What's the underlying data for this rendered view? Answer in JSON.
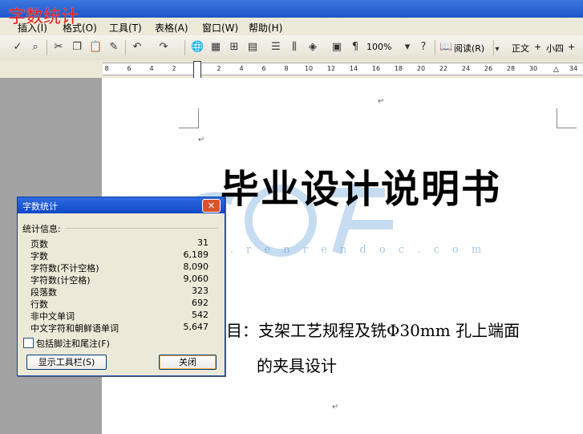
{
  "banner": "字数统计",
  "menu": [
    "插入(I)",
    "格式(O)",
    "工具(T)",
    "表格(A)",
    "窗口(W)",
    "帮助(H)"
  ],
  "toolbar": {
    "zoom": "100%",
    "read_label": "阅读(R)",
    "style_value": "正文",
    "font_size": "小四"
  },
  "ruler": [
    "8",
    "6",
    "4",
    "2",
    "2",
    "4",
    "6",
    "8",
    "10",
    "12",
    "14",
    "16",
    "18",
    "20",
    "22",
    "24",
    "26",
    "28",
    "30",
    "34"
  ],
  "document": {
    "title": "毕业设计说明书",
    "line1": "目：支架工艺规程及铣Φ30mm 孔上端面",
    "line2": "的夹具设计",
    "para_mark": "↵"
  },
  "watermark": {
    "url": "w w w . r e n r e n d o c . c o m"
  },
  "dialog": {
    "title": "字数统计",
    "close_glyph": "✕",
    "section": "统计信息:",
    "stats": [
      {
        "label": "页数",
        "value": "31"
      },
      {
        "label": "字数",
        "value": "6,189"
      },
      {
        "label": "字符数(不计空格)",
        "value": "8,090"
      },
      {
        "label": "字符数(计空格)",
        "value": "9,060"
      },
      {
        "label": "段落数",
        "value": "323"
      },
      {
        "label": "行数",
        "value": "692"
      },
      {
        "label": "非中文单词",
        "value": "542"
      },
      {
        "label": "中文字符和朝鲜语单词",
        "value": "5,647"
      }
    ],
    "include_footnotes": "包括脚注和尾注(F)",
    "show_toolbar": "显示工具栏(S)",
    "close": "关闭"
  }
}
